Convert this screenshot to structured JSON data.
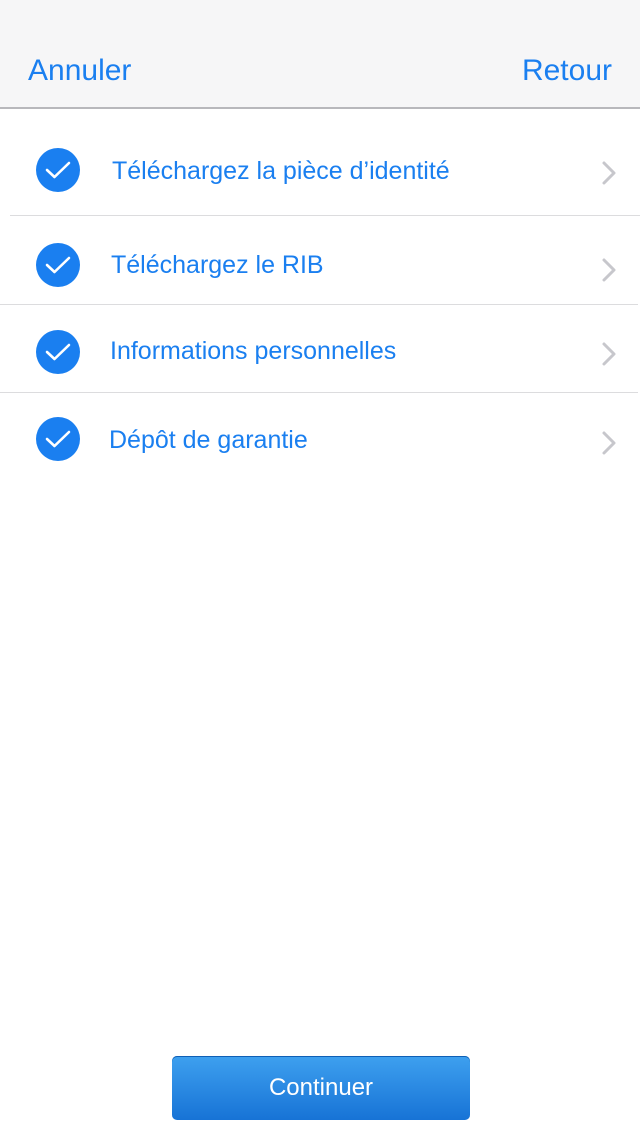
{
  "navbar": {
    "cancel_label": "Annuler",
    "back_label": "Retour"
  },
  "steps": [
    {
      "label": "Téléchargez la pièce d’identité",
      "completed": true,
      "icon": "checkmark-icon"
    },
    {
      "label": "Téléchargez le RIB",
      "completed": true,
      "icon": "checkmark-icon"
    },
    {
      "label": "Informations personnelles",
      "completed": true,
      "icon": "checkmark-icon"
    },
    {
      "label": "Dépôt de garantie",
      "completed": true,
      "icon": "checkmark-icon"
    }
  ],
  "footer": {
    "continue_label": "Continuer"
  },
  "colors": {
    "accent": "#1a7ff0",
    "navbar_bg": "#f6f6f7",
    "chevron": "#c7c7cc",
    "button_top": "#3ea0ef",
    "button_bottom": "#1773d6"
  }
}
